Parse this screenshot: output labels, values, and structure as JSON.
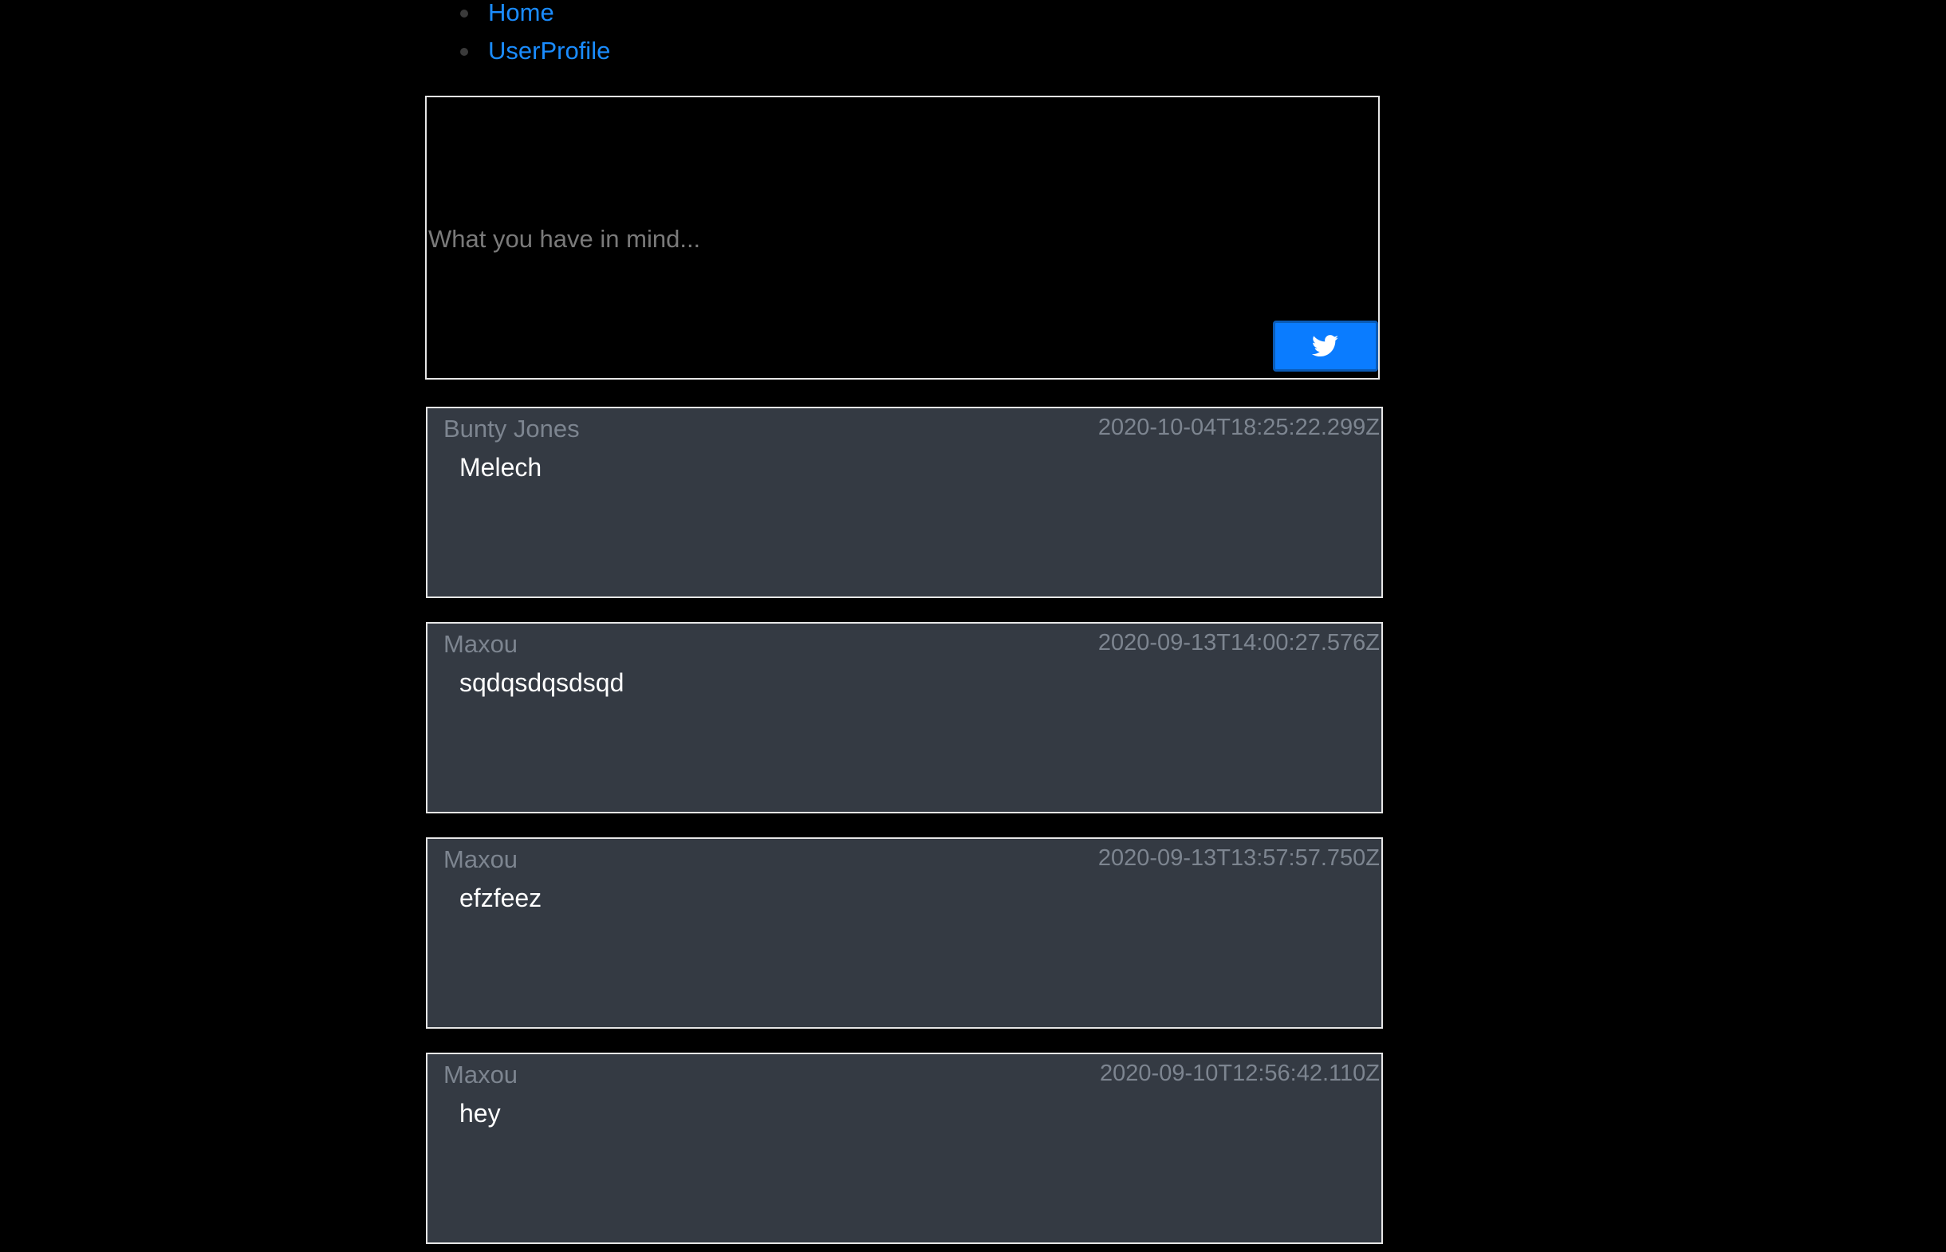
{
  "nav": {
    "items": [
      {
        "label": "Home"
      },
      {
        "label": "UserProfile"
      }
    ]
  },
  "composer": {
    "placeholder": "What you have in mind...",
    "value": "",
    "submit_icon": "twitter-bird-icon"
  },
  "colors": {
    "background": "#000000",
    "link": "#1a8cff",
    "button": "#0a7cff",
    "card": "#343a43",
    "muted_text": "#7d8590"
  },
  "tweets": [
    {
      "author": "Bunty Jones",
      "date": "2020-10-04T18:25:22.299Z",
      "content": "Melech"
    },
    {
      "author": "Maxou",
      "date": "2020-09-13T14:00:27.576Z",
      "content": "sqdqsdqsdsqd"
    },
    {
      "author": "Maxou",
      "date": "2020-09-13T13:57:57.750Z",
      "content": "efzfeez"
    },
    {
      "author": "Maxou",
      "date": "2020-09-10T12:56:42.110Z",
      "content": "hey"
    }
  ]
}
